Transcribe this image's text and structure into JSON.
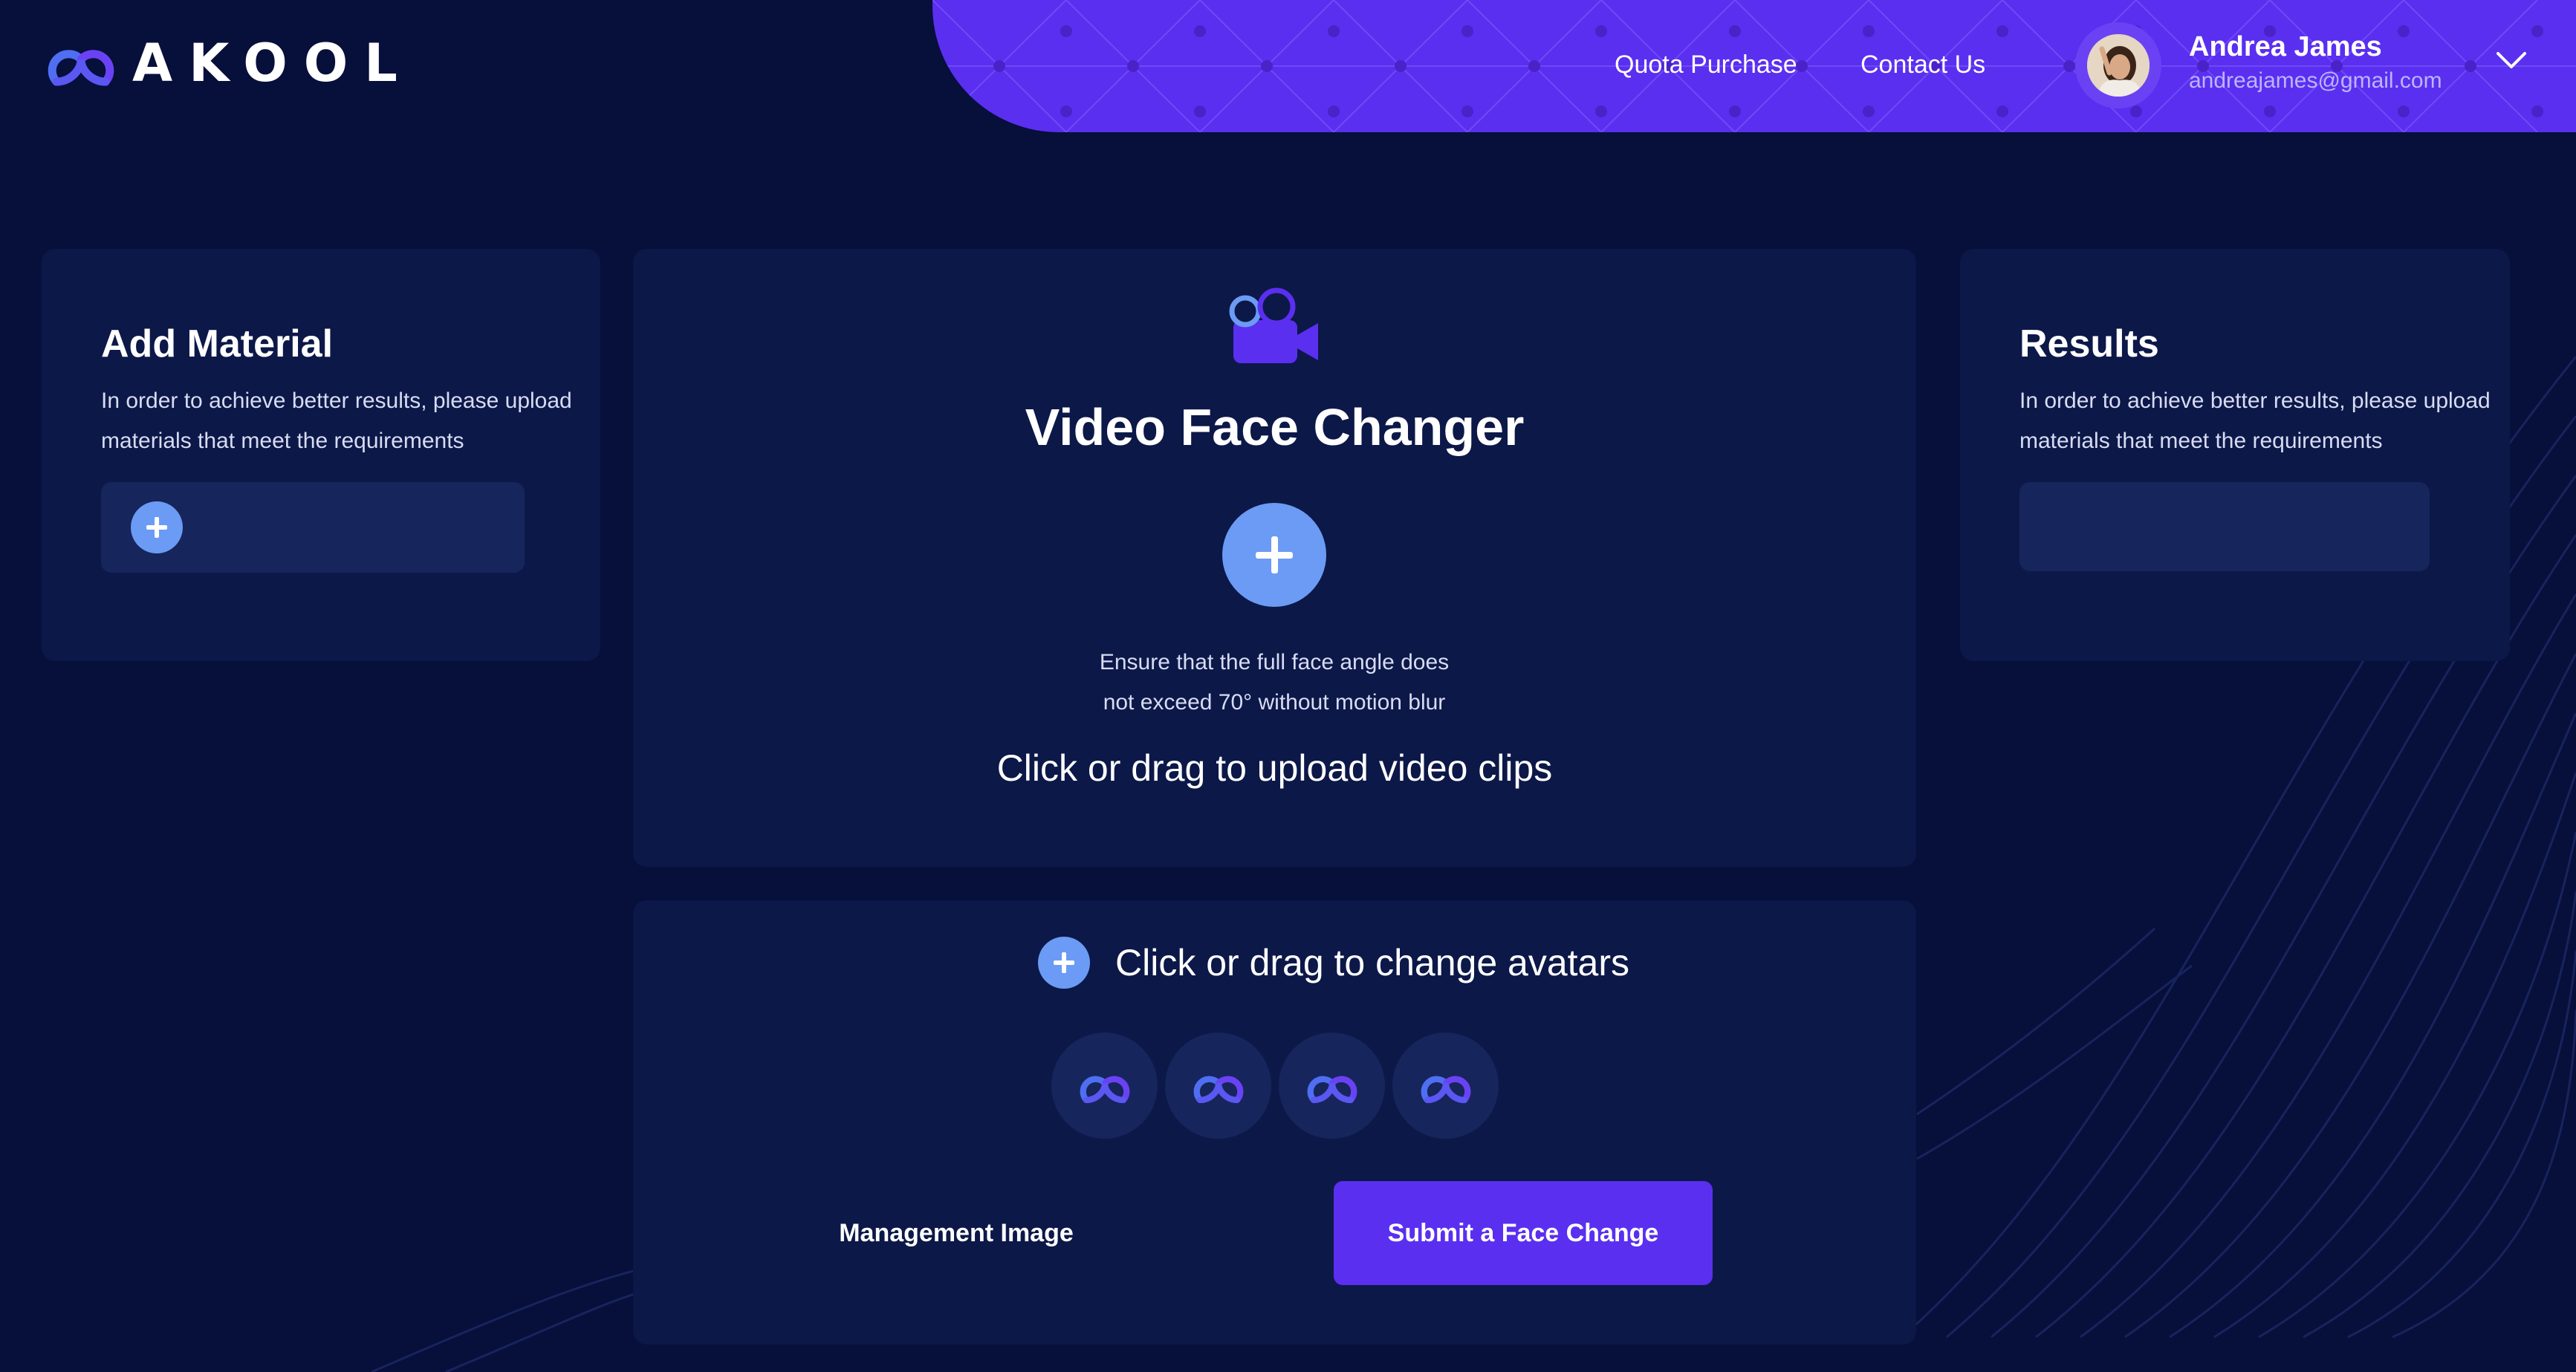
{
  "brand": {
    "name": "AKOOL",
    "logo_icon": "akool-logo-icon",
    "accent": "#5a2ff0",
    "plus_color": "#6b9bf4",
    "background": "#070f3b",
    "panel_bg": "#0c1848"
  },
  "header": {
    "nav": [
      {
        "label": "Quota Purchase"
      },
      {
        "label": "Contact Us"
      }
    ],
    "user": {
      "name": "Andrea James",
      "email": "andreajames@gmail.com",
      "menu_icon": "chevron-down-icon"
    }
  },
  "add_material": {
    "title": "Add Material",
    "subtitle": "In order to achieve better results, please upload materials that meet the requirements"
  },
  "video": {
    "icon": "video-camera-icon",
    "title": "Video Face Changer",
    "hint": "Ensure that the full face angle does not exceed 70° without motion blur",
    "upload_label": "Click or drag to upload video clips"
  },
  "results": {
    "title": "Results",
    "subtitle": "In order to achieve better results, please upload materials that meet the requirements"
  },
  "avatars": {
    "label": "Click or drag to change avatars",
    "slots": [
      "akool-logo-icon",
      "akool-logo-icon",
      "akool-logo-icon",
      "akool-logo-icon"
    ]
  },
  "actions": {
    "manage_label": "Management Image",
    "submit_label": "Submit a Face Change"
  }
}
